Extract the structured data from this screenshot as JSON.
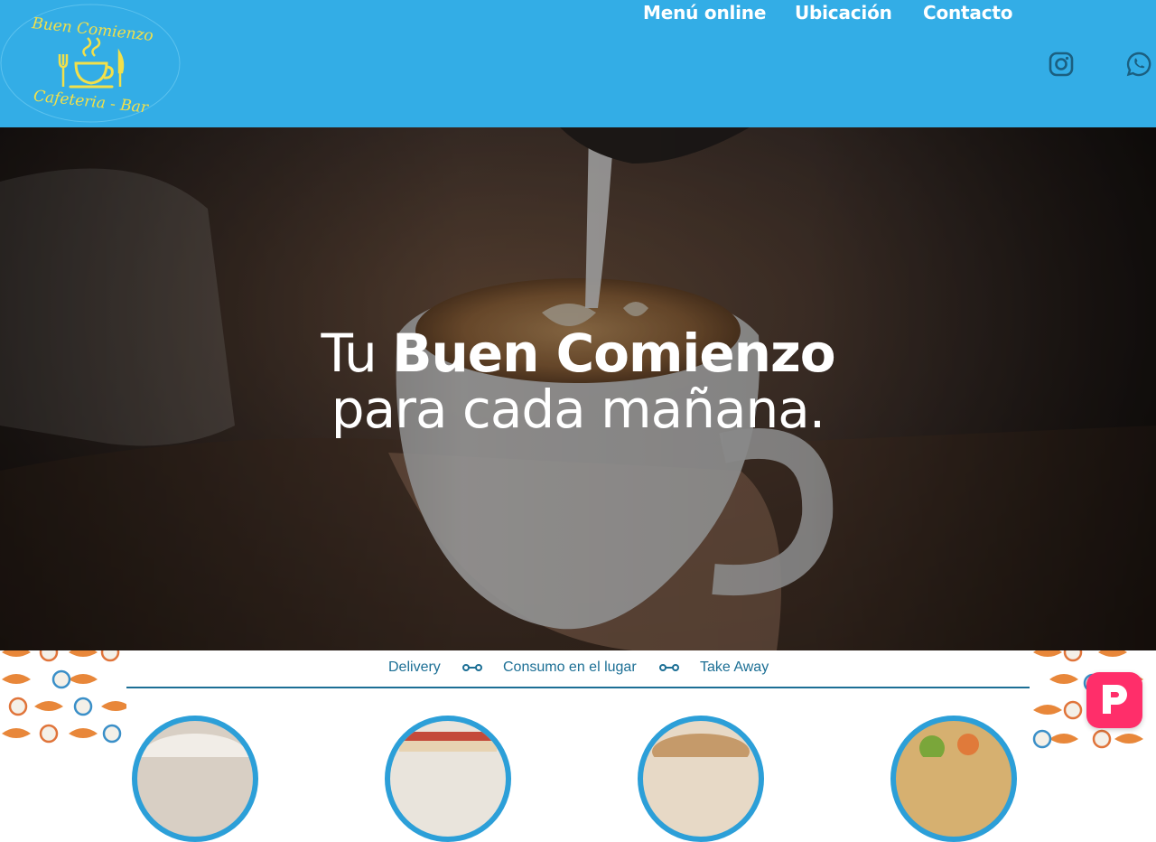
{
  "brand": {
    "logo_top_text": "Buen Comienzo",
    "logo_bottom_text": "Cafeteria - Bar",
    "colors": {
      "header_bg": "#33ade6",
      "logo_gold": "#f2e04a",
      "accent_blue": "#1c6f95",
      "fab_pink": "#ff2e6a"
    }
  },
  "nav": {
    "items": [
      {
        "label": "Menú online"
      },
      {
        "label": "Ubicación"
      },
      {
        "label": "Contacto"
      }
    ],
    "icons": [
      "instagram-icon",
      "whatsapp-icon"
    ]
  },
  "hero": {
    "line1_light": "Tu",
    "line1_bold": "Buen Comienzo",
    "line2": "para cada mañana."
  },
  "services": {
    "items": [
      {
        "label": "Delivery"
      },
      {
        "label": "Consumo en el lugar"
      },
      {
        "label": "Take Away"
      }
    ],
    "separator_icon": "link-icon"
  },
  "products": {
    "count_visible": 4
  },
  "widget": {
    "icon": "p-chat-icon"
  }
}
